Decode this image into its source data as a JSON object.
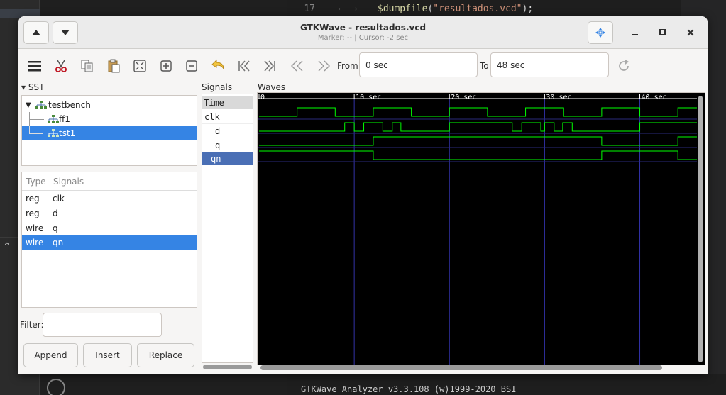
{
  "background": {
    "code_line_number": "17",
    "code_function": "$dumpfile",
    "code_open": "(",
    "code_string": "\"resultados.vcd\"",
    "code_close": ");",
    "terminal_text": "GTKWave Analyzer v3.3.108 (w)1999-2020 BSI"
  },
  "window": {
    "title": "GTKWave - resultados.vcd",
    "subtitle": "Marker: --  |  Cursor: -2 sec"
  },
  "toolbar": {
    "from_label": "From:",
    "from_value": "0 sec",
    "to_label": "To:",
    "to_value": "48 sec"
  },
  "sst": {
    "header": "SST",
    "tree": [
      {
        "label": "testbench",
        "level": 0,
        "selected": false
      },
      {
        "label": "ff1",
        "level": 1,
        "selected": false
      },
      {
        "label": "tst1",
        "level": 1,
        "selected": true
      }
    ],
    "table_headers": [
      "Type",
      "Signals"
    ],
    "signals": [
      {
        "type": "reg",
        "name": "clk",
        "selected": false
      },
      {
        "type": "reg",
        "name": "d",
        "selected": false
      },
      {
        "type": "wire",
        "name": "q",
        "selected": false
      },
      {
        "type": "wire",
        "name": "qn",
        "selected": true
      }
    ],
    "filter_label": "Filter:",
    "filter_value": "",
    "buttons": {
      "append": "Append",
      "insert": "Insert",
      "replace": "Replace"
    }
  },
  "signals_pane": {
    "header": "Signals",
    "rows": [
      {
        "label": "Time",
        "style": "time"
      },
      {
        "label": "clk",
        "style": "normal"
      },
      {
        "label": "d",
        "style": "indent"
      },
      {
        "label": "q",
        "style": "indent"
      },
      {
        "label": "qn",
        "style": "selected"
      }
    ]
  },
  "waves": {
    "header": "Waves",
    "time_max": 46,
    "time_labels": [
      {
        "t": 0,
        "label": "0"
      },
      {
        "t": 10,
        "label": "10 sec"
      },
      {
        "t": 20,
        "label": "20 sec"
      },
      {
        "t": 30,
        "label": "30 sec"
      },
      {
        "t": 40,
        "label": "40 sec"
      }
    ],
    "colors": {
      "background": "#000000",
      "wave": "#00ff00",
      "grid": "#3232a8",
      "label": "#ffffff"
    },
    "traces": [
      {
        "name": "clk",
        "initial": 0,
        "toggles": [
          4,
          8,
          12,
          16,
          20,
          24,
          28,
          32,
          36,
          40,
          44
        ]
      },
      {
        "name": "d",
        "initial": 0,
        "toggles": [
          9,
          10,
          11,
          13,
          14,
          14.9,
          20,
          26.6,
          27.6,
          29.6,
          30,
          31,
          31.9,
          32.9,
          40
        ]
      },
      {
        "name": "q",
        "initial": 0,
        "toggles": [
          12,
          36,
          44
        ]
      },
      {
        "name": "qn",
        "initial": 1,
        "toggles": [
          12,
          36,
          44
        ]
      }
    ]
  }
}
